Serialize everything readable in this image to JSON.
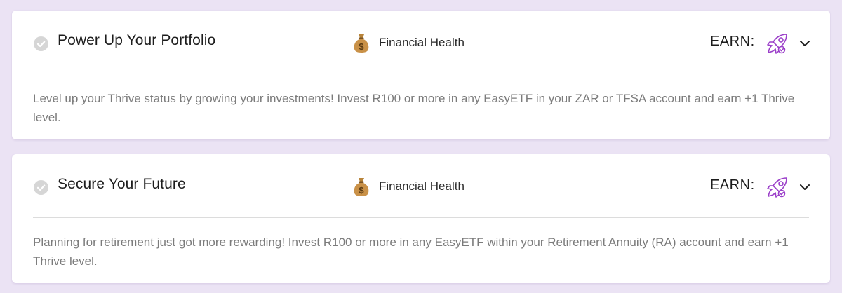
{
  "colors": {
    "page_background": "#ebe3f4",
    "card_background": "#ffffff",
    "check_circle": "#d6d6d6",
    "rocket_purple": "#9b3fc9",
    "description_text": "#7b7b7b"
  },
  "cards": [
    {
      "title": "Power Up Your Portfolio",
      "category": "Financial Health",
      "category_icon": "money-bag-icon",
      "earn_label": "EARN:",
      "reward_icon": "rocket-icon",
      "completed_icon": "check-circle-icon",
      "description": "Level up your Thrive status by growing your investments! Invest R100 or more in any EasyETF in your ZAR or TFSA account and earn +1 Thrive level."
    },
    {
      "title": "Secure Your Future",
      "category": "Financial Health",
      "category_icon": "money-bag-icon",
      "earn_label": "EARN:",
      "reward_icon": "rocket-icon",
      "completed_icon": "check-circle-icon",
      "description": "Planning for retirement just got more rewarding! Invest R100 or more in any EasyETF within your Retirement Annuity (RA) account and earn +1 Thrive level."
    }
  ]
}
